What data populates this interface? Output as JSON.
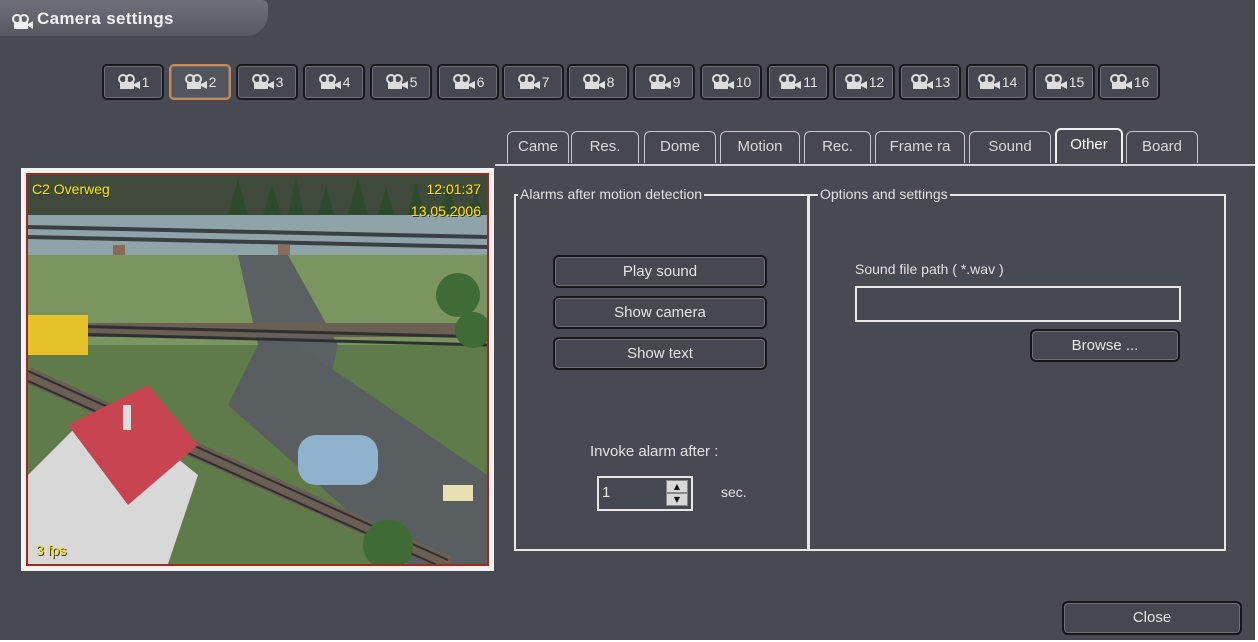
{
  "window": {
    "title": "Camera settings"
  },
  "cameras": {
    "selected": 2,
    "buttons": [
      "1",
      "2",
      "3",
      "4",
      "5",
      "6",
      "7",
      "8",
      "9",
      "10",
      "11",
      "12",
      "13",
      "14",
      "15",
      "16"
    ]
  },
  "tabs": {
    "items": [
      "Came",
      "Res.",
      "Dome",
      "Motion",
      "Rec.",
      "Frame ra",
      "Sound",
      "Other",
      "Board"
    ],
    "active": "Other"
  },
  "preview": {
    "camera_label": "C2 Overweg",
    "time": "12:01:37",
    "date": "13.05.2006",
    "fps": "3 fps"
  },
  "alarms": {
    "legend": "Alarms after motion detection",
    "play_sound": "Play sound",
    "show_camera": "Show camera",
    "show_text": "Show text",
    "invoke_label": "Invoke alarm after :",
    "invoke_value": "1",
    "unit": "sec."
  },
  "options": {
    "legend": "Options and settings",
    "sound_path_label": "Sound file path ( *.wav )",
    "sound_path_value": "",
    "browse": "Browse ..."
  },
  "footer": {
    "close": "Close"
  },
  "colors": {
    "background": "#474a50",
    "active_camera_border": "#c98a54",
    "osd_text": "#ffe600",
    "preview_border": "#a0281e"
  }
}
